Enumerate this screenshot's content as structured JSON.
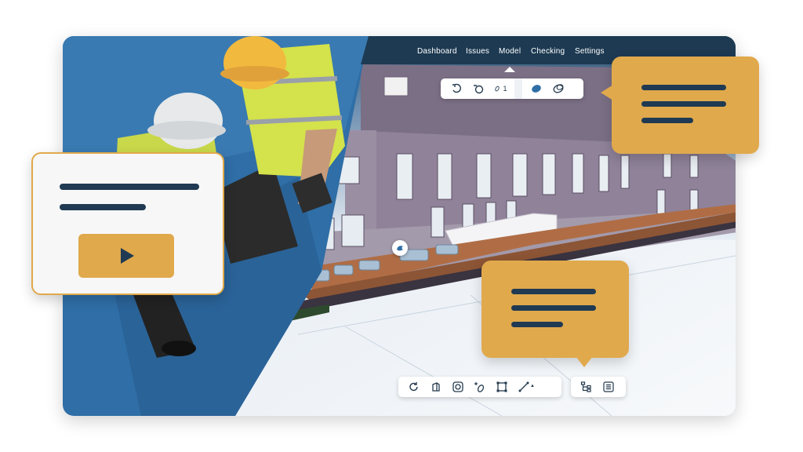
{
  "colors": {
    "accent": "#e0a94c",
    "dark": "#1f3a52",
    "nav_bg": "#1d3a52",
    "photo_blue": "#2e6fa8",
    "building": "#8a7d93",
    "floor": "#b06d45"
  },
  "nav": {
    "tabs": [
      {
        "label": "Dashboard"
      },
      {
        "label": "Issues"
      },
      {
        "label": "Model",
        "active": true
      },
      {
        "label": "Checking"
      },
      {
        "label": "Settings"
      }
    ]
  },
  "top_toolbar": {
    "tools": [
      {
        "icon": "orbit-icon"
      },
      {
        "icon": "pan-icon"
      },
      {
        "icon": "walk-icon",
        "value": "1"
      },
      {
        "icon": "fill-color-icon"
      },
      {
        "icon": "transparency-icon"
      }
    ]
  },
  "bottom_toolbar": {
    "tools": [
      {
        "icon": "reset-view-icon"
      },
      {
        "icon": "cube-view-icon"
      },
      {
        "icon": "focus-icon"
      },
      {
        "icon": "add-markup-icon"
      },
      {
        "icon": "section-box-icon"
      },
      {
        "icon": "measure-icon"
      },
      {
        "icon": "model-tree-icon"
      },
      {
        "icon": "properties-list-icon"
      }
    ]
  },
  "callouts": {
    "video_card": {
      "icon": "play-icon"
    },
    "top_right": {
      "icon": "text-lines-icon"
    },
    "bottom_right": {
      "icon": "text-lines-icon"
    }
  }
}
